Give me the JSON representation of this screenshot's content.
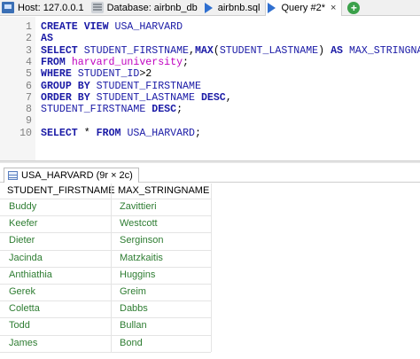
{
  "tabs": [
    {
      "label": "Host: 127.0.0.1",
      "icon": "host-icon"
    },
    {
      "label": "Database: airbnb_db",
      "icon": "database-icon"
    },
    {
      "label": "airbnb.sql",
      "icon": "play-icon"
    },
    {
      "label": "Query #2*",
      "icon": "play-icon",
      "close": "×"
    },
    {
      "label": "+",
      "icon": "add-tab-icon"
    }
  ],
  "editor": {
    "lines": [
      {
        "n": "1",
        "html": "<span class=\"kw\">CREATE VIEW</span> <span class=\"id\">USA_HARVARD</span>"
      },
      {
        "n": "2",
        "html": "<span class=\"kw\">AS</span>"
      },
      {
        "n": "3",
        "html": "<span class=\"kw\">SELECT</span> <span class=\"id\">STUDENT_FIRSTNAME</span><span class=\"op\">,</span><span class=\"kw\">MAX</span><span class=\"op\">(</span><span class=\"id\">STUDENT_LASTNAME</span><span class=\"op\">)</span> <span class=\"kw\">AS</span> <span class=\"id\">MAX_STRINGNAME</span>"
      },
      {
        "n": "4",
        "html": "<span class=\"kw\">FROM</span> <span class=\"str\">harvard_university</span><span class=\"op\">;</span>"
      },
      {
        "n": "5",
        "html": "<span class=\"kw\">WHERE</span> <span class=\"id\">STUDENT_ID</span><span class=\"op\">&gt;2</span>"
      },
      {
        "n": "6",
        "html": "<span class=\"kw\">GROUP BY</span> <span class=\"id\">STUDENT_FIRSTNAME</span>"
      },
      {
        "n": "7",
        "html": "<span class=\"kw\">ORDER BY</span> <span class=\"id\">STUDENT_LASTNAME</span> <span class=\"kw\">DESC</span><span class=\"op\">,</span>"
      },
      {
        "n": "8",
        "html": "<span class=\"id\">STUDENT_FIRSTNAME</span> <span class=\"kw\">DESC</span><span class=\"op\">;</span>"
      },
      {
        "n": "9",
        "html": ""
      },
      {
        "n": "10",
        "html": "<span class=\"kw\">SELECT</span> <span class=\"op\">*</span> <span class=\"kw\">FROM</span> <span class=\"id\">USA_HARVARD</span><span class=\"op\">;</span>"
      }
    ]
  },
  "result_tab": {
    "label": "USA_HARVARD (9r × 2c)"
  },
  "grid": {
    "columns": [
      "STUDENT_FIRSTNAME",
      "MAX_STRINGNAME"
    ],
    "rows": [
      [
        "Buddy",
        "Zavittieri"
      ],
      [
        "Keefer",
        "Westcott"
      ],
      [
        "Dieter",
        "Serginson"
      ],
      [
        "Jacinda",
        "Matzkaitis"
      ],
      [
        "Anthiathia",
        "Huggins"
      ],
      [
        "Gerek",
        "Greim"
      ],
      [
        "Coletta",
        "Dabbs"
      ],
      [
        "Todd",
        "Bullan"
      ],
      [
        "James",
        "Bond"
      ]
    ]
  }
}
